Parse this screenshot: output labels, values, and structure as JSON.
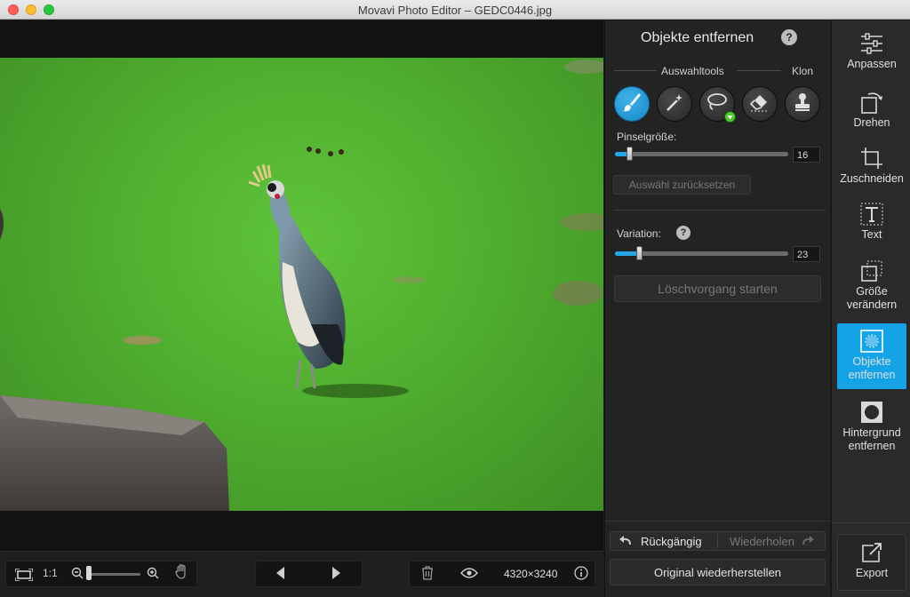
{
  "window": {
    "title": "Movavi Photo Editor – GEDC0446.jpg"
  },
  "panel": {
    "title": "Objekte entfernen",
    "selection_tools_label": "Auswahltools",
    "clone_label": "Klon",
    "brush_size_label": "Pinselgröße:",
    "brush_size_value": "16",
    "brush_size_fraction": 0.08,
    "reset_selection_label": "Auswähl zurücksetzen",
    "variation_label": "Variation:",
    "variation_value": "23",
    "variation_fraction": 0.14,
    "start_removal_label": "Löschvorgang starten",
    "undo_label": "Rückgängig",
    "redo_label": "Wiederholen",
    "restore_label": "Original wiederherstellen"
  },
  "sidebar": {
    "items": [
      {
        "label": "Anpassen",
        "icon": "sliders-icon"
      },
      {
        "label": "Drehen",
        "icon": "rotate-icon"
      },
      {
        "label": "Zuschneiden",
        "icon": "crop-icon"
      },
      {
        "label": "Text",
        "icon": "text-icon"
      },
      {
        "label": "Größe verändern",
        "icon": "resize-icon"
      },
      {
        "label": "Objekte entfernen",
        "icon": "object-removal-icon",
        "active": true
      },
      {
        "label": "Hintergrund entfernen",
        "icon": "background-removal-icon"
      }
    ],
    "export_label": "Export"
  },
  "bottombar": {
    "zoom_label": "1:1",
    "dimensions": "4320×3240"
  },
  "colors": {
    "accent": "#14a3e6",
    "panel": "#232323",
    "sidebar": "#2a2a2a"
  }
}
